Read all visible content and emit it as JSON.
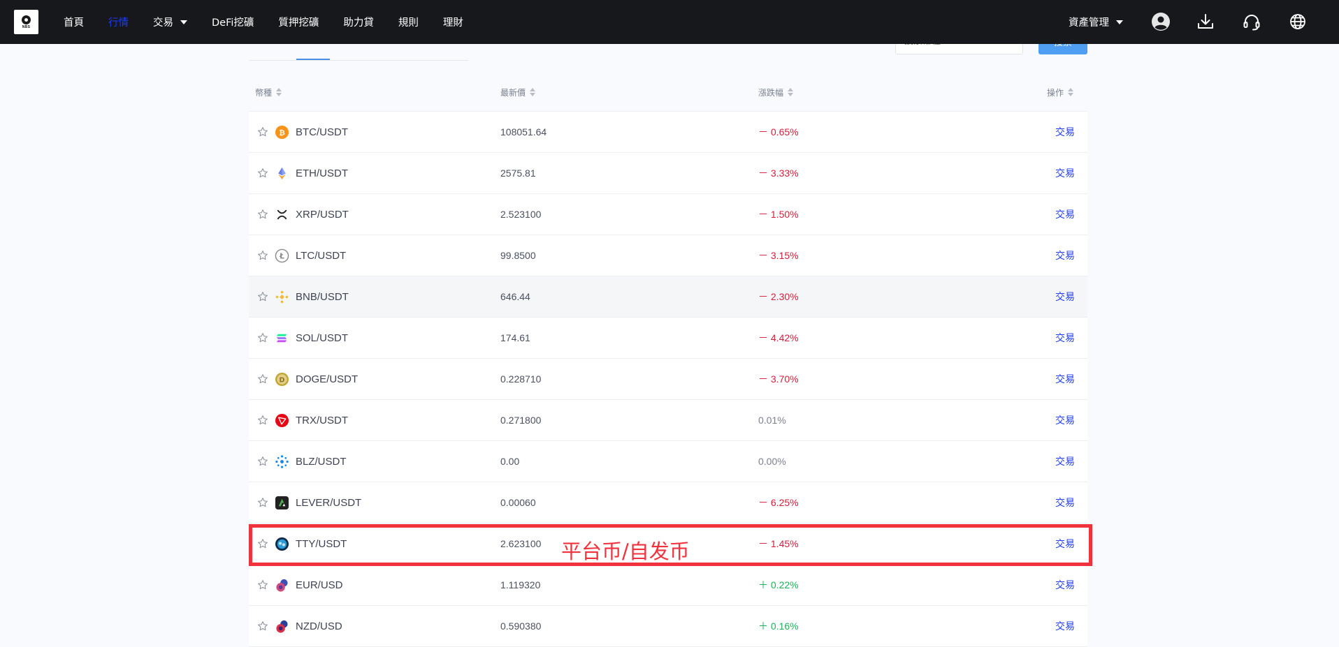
{
  "brand": {
    "logo_text": "NBS"
  },
  "nav": {
    "items": [
      {
        "label": "首頁"
      },
      {
        "label": "行情"
      },
      {
        "label": "交易"
      },
      {
        "label": "DeFi挖礦"
      },
      {
        "label": "質押挖礦"
      },
      {
        "label": "助力貸"
      },
      {
        "label": "規則"
      },
      {
        "label": "理財"
      }
    ],
    "active_index": 1,
    "asset_management": "資產管理"
  },
  "header_icons": [
    "user-icon",
    "download-icon",
    "headset-icon",
    "globe-icon"
  ],
  "search": {
    "placeholder": "搜索幣種",
    "button_label": "搜索"
  },
  "table": {
    "headers": {
      "coin": "幣種",
      "price": "最新價",
      "change": "漲跌幅",
      "action": "操作"
    },
    "rows": [
      {
        "pair": "BTC/USDT",
        "price": "108051.64",
        "change": "－ 0.65%",
        "trend": "down",
        "action": "交易",
        "icon": "btc-icon"
      },
      {
        "pair": "ETH/USDT",
        "price": "2575.81",
        "change": "－ 3.33%",
        "trend": "down",
        "action": "交易",
        "icon": "eth-icon"
      },
      {
        "pair": "XRP/USDT",
        "price": "2.523100",
        "change": "－ 1.50%",
        "trend": "down",
        "action": "交易",
        "icon": "xrp-icon"
      },
      {
        "pair": "LTC/USDT",
        "price": "99.8500",
        "change": "－ 3.15%",
        "trend": "down",
        "action": "交易",
        "icon": "ltc-icon"
      },
      {
        "pair": "BNB/USDT",
        "price": "646.44",
        "change": "－ 2.30%",
        "trend": "down",
        "action": "交易",
        "icon": "bnb-icon"
      },
      {
        "pair": "SOL/USDT",
        "price": "174.61",
        "change": "－ 4.42%",
        "trend": "down",
        "action": "交易",
        "icon": "sol-icon"
      },
      {
        "pair": "DOGE/USDT",
        "price": "0.228710",
        "change": "－ 3.70%",
        "trend": "down",
        "action": "交易",
        "icon": "doge-icon"
      },
      {
        "pair": "TRX/USDT",
        "price": "0.271800",
        "change": "0.01%",
        "trend": "flat",
        "action": "交易",
        "icon": "trx-icon"
      },
      {
        "pair": "BLZ/USDT",
        "price": "0.00",
        "change": "0.00%",
        "trend": "flat",
        "action": "交易",
        "icon": "blz-icon"
      },
      {
        "pair": "LEVER/USDT",
        "price": "0.00060",
        "change": "－ 6.25%",
        "trend": "down",
        "action": "交易",
        "icon": "lever-icon"
      },
      {
        "pair": "TTY/USDT",
        "price": "2.623100",
        "change": "－ 1.45%",
        "trend": "down",
        "action": "交易",
        "icon": "tty-icon"
      },
      {
        "pair": "EUR/USD",
        "price": "1.119320",
        "change": "＋ 0.22%",
        "trend": "up",
        "action": "交易",
        "icon": "eur-icon"
      },
      {
        "pair": "NZD/USD",
        "price": "0.590380",
        "change": "＋ 0.16%",
        "trend": "up",
        "action": "交易",
        "icon": "nzd-icon"
      }
    ],
    "hover_row_index": 4
  },
  "annotation": {
    "text": "平台币/自发币",
    "target_row_index": 10
  },
  "colors": {
    "topbar": "#17181c",
    "nav_active": "#1f3df0",
    "down": "#d21f3c",
    "up": "#1fb15a",
    "link": "#1f3df0",
    "annotation": "#f0323c",
    "search_button": "#4f9ef4"
  }
}
